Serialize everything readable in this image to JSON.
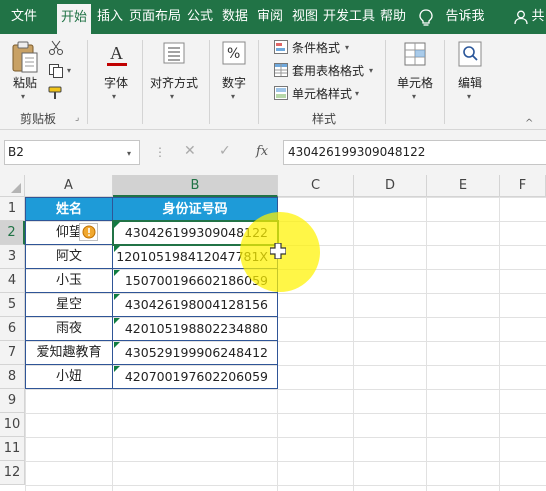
{
  "tabs": [
    "文件",
    "开始",
    "插入",
    "页面布局",
    "公式",
    "数据",
    "审阅",
    "视图",
    "开发工具",
    "帮助"
  ],
  "active_tab": "开始",
  "tell_me": "告诉我",
  "share_label": "共",
  "ribbon": {
    "clipboard": {
      "paste": "粘贴",
      "group": "剪贴板"
    },
    "font": "字体",
    "alignment": "对齐方式",
    "number": "数字",
    "styles": {
      "conditional": "条件格式",
      "table": "套用表格格式",
      "cell_styles": "单元格样式",
      "group": "样式"
    },
    "cells": "单元格",
    "editing": "编辑"
  },
  "namebox": "B2",
  "formula_icon": "fx",
  "formula_value": "430426199309048122",
  "columns": [
    "A",
    "B",
    "C",
    "D",
    "E",
    "F"
  ],
  "rows": [
    "1",
    "2",
    "3",
    "4",
    "5",
    "6",
    "7",
    "8",
    "9",
    "10",
    "11",
    "12"
  ],
  "table": {
    "headers": [
      "姓名",
      "身份证号码"
    ],
    "rows": [
      [
        "仰望",
        "430426199309048122"
      ],
      [
        "阿文",
        "120105198412047781X"
      ],
      [
        "小玉",
        "150700196602186059"
      ],
      [
        "星空",
        "430426198004128156"
      ],
      [
        "雨夜",
        "420105198802234880"
      ],
      [
        "爱知趣教育",
        "430529199906248412"
      ],
      [
        "小妞",
        "420700197602206059"
      ]
    ]
  },
  "colors": {
    "excel_green": "#217346",
    "header_fill": "#1e9bd8",
    "border": "#2f5597",
    "highlight": "#fff200"
  }
}
